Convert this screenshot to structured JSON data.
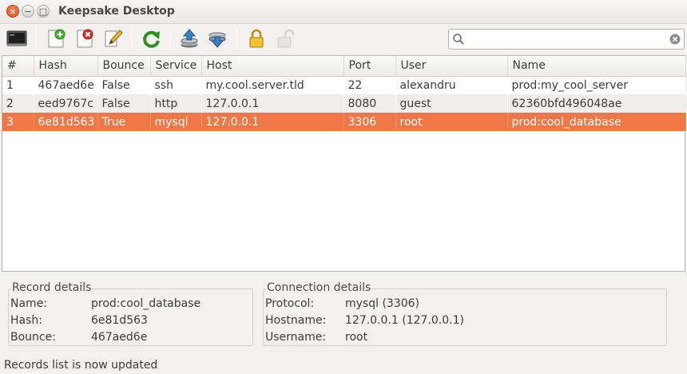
{
  "window": {
    "title": "Keepsake Desktop",
    "close_glyph": "×",
    "minimize_glyph": "−",
    "maximize_glyph": "□"
  },
  "toolbar": {
    "buttons": [
      {
        "name": "terminal-icon"
      },
      {
        "name": "add-record-icon"
      },
      {
        "name": "delete-record-icon"
      },
      {
        "name": "edit-record-icon"
      },
      {
        "name": "refresh-icon"
      },
      {
        "name": "upload-icon"
      },
      {
        "name": "download-icon"
      },
      {
        "name": "lock-icon"
      },
      {
        "name": "unlock-icon"
      }
    ],
    "search": {
      "value": "",
      "placeholder": ""
    }
  },
  "table": {
    "columns": [
      "#",
      "Hash",
      "Bounce",
      "Service",
      "Host",
      "Port",
      "User",
      "Name"
    ],
    "rows": [
      [
        "1",
        "467aed6e",
        "False",
        "ssh",
        "my.cool.server.tld",
        "22",
        "alexandru",
        "prod:my_cool_server"
      ],
      [
        "2",
        "eed9767c",
        "False",
        "http",
        "127.0.0.1",
        "8080",
        "guest",
        "62360bfd496048ae"
      ],
      [
        "3",
        "6e81d563",
        "True",
        "mysql",
        "127.0.0.1",
        "3306",
        "root",
        "prod:cool_database"
      ]
    ],
    "selected_row": 3
  },
  "record_details": {
    "title": "Record details",
    "fields": [
      {
        "label": "Name:",
        "value": "prod:cool_database"
      },
      {
        "label": "Hash:",
        "value": "6e81d563"
      },
      {
        "label": "Bounce:",
        "value": "467aed6e"
      }
    ]
  },
  "connection_details": {
    "title": "Connection details",
    "fields": [
      {
        "label": "Protocol:",
        "value": "mysql (3306)"
      },
      {
        "label": "Hostname:",
        "value": "127.0.0.1 (127.0.0.1)"
      },
      {
        "label": "Username:",
        "value": "root"
      }
    ]
  },
  "status_bar": {
    "text": "Records list is now updated"
  },
  "colors": {
    "selection": "#f07746",
    "close_button": "#e0481c"
  }
}
